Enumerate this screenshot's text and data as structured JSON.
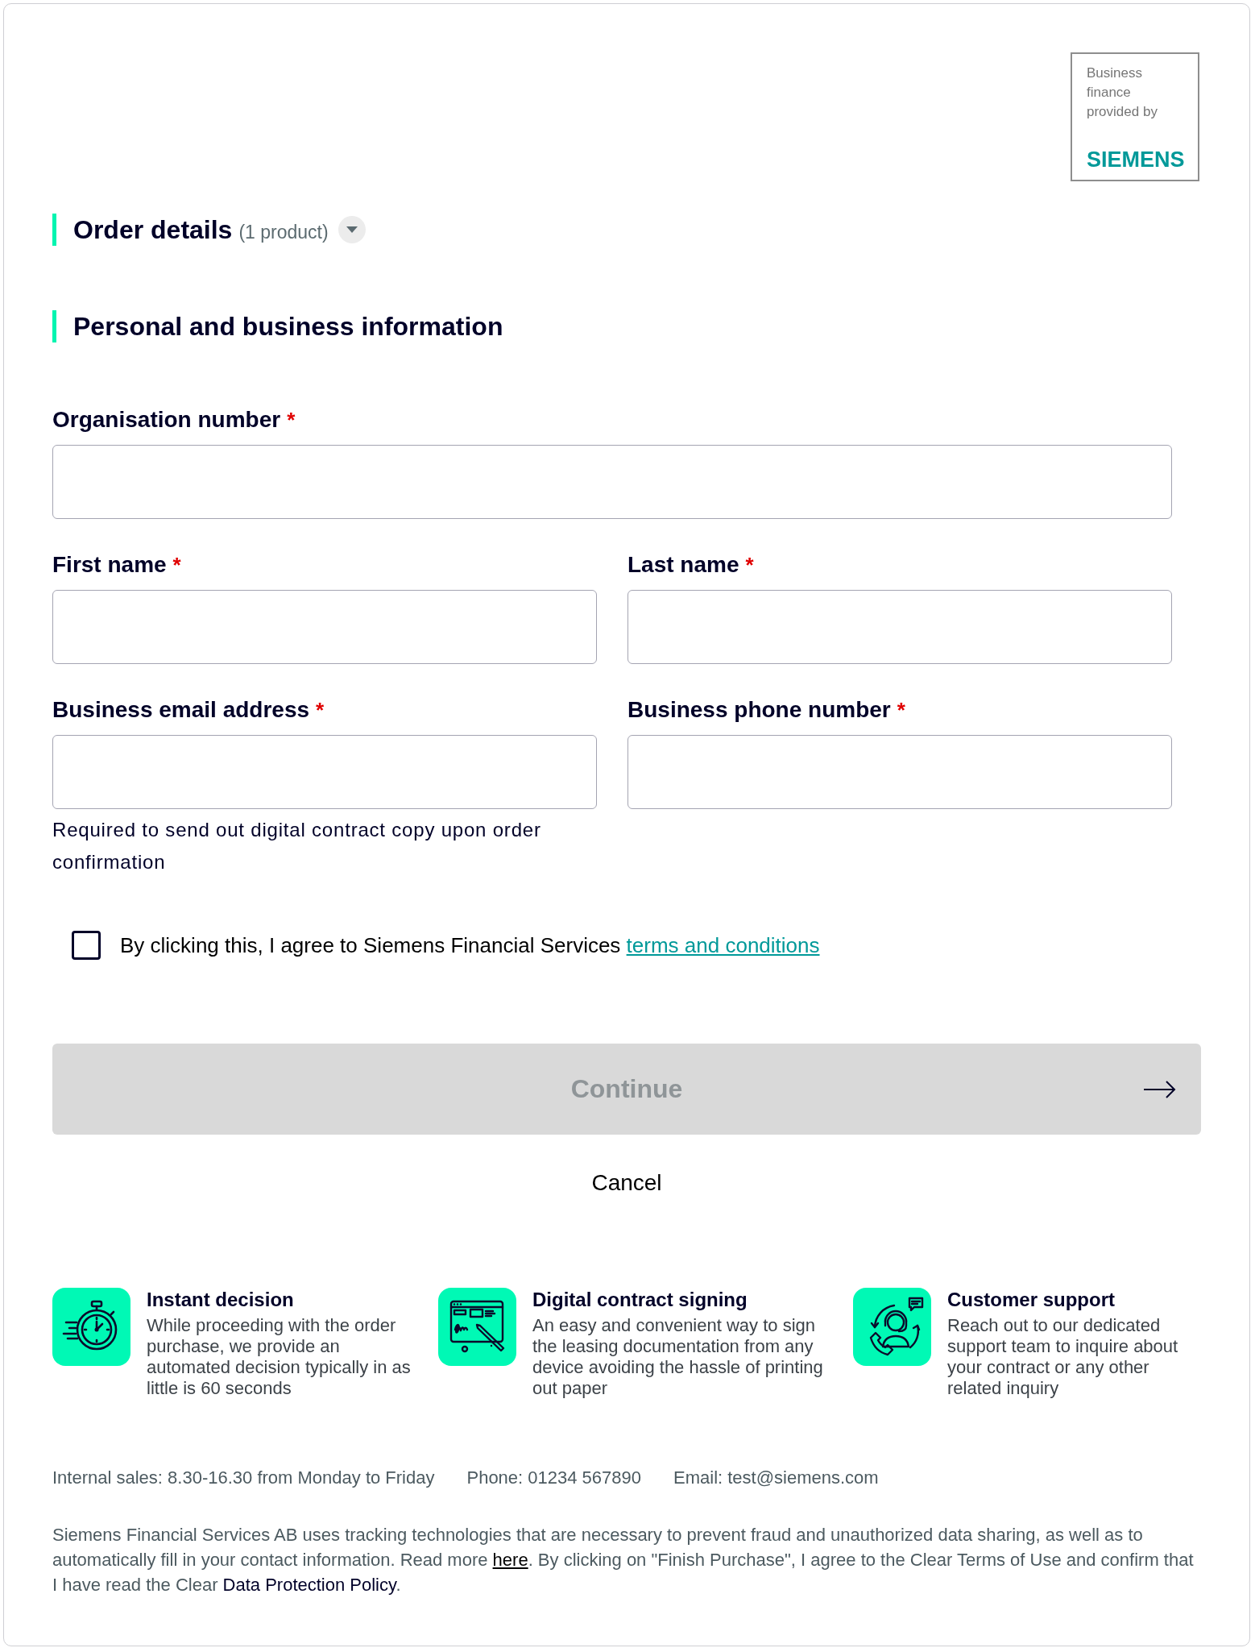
{
  "logo": {
    "tagline": "Business finance provided by",
    "brand": "SIEMENS"
  },
  "order_details": {
    "title": "Order details",
    "count": "(1 product)",
    "expanded": false
  },
  "personal_section": {
    "title": "Personal and business information"
  },
  "form": {
    "required_marker": "*",
    "rows": [
      [
        {
          "label": "Organisation number",
          "required": true
        }
      ],
      [
        {
          "label": "First name",
          "required": true
        },
        {
          "label": "Last name",
          "required": true
        }
      ],
      [
        {
          "label": "Business email address",
          "required": true,
          "helper": "Required to send out digital contract copy upon order confirmation"
        },
        {
          "label": "Business phone number",
          "required": true
        }
      ]
    ]
  },
  "agreement": {
    "text": "By clicking this, I agree to Siemens Financial Services",
    "link": "terms and conditions",
    "checked": false
  },
  "continue_button": {
    "label": "Continue",
    "disabled": true
  },
  "cancel": {
    "label": "Cancel"
  },
  "features": [
    {
      "kind": "stopwatch",
      "title": "Instant decision",
      "description": "While proceeding with the order purchase, we provide an automated decision typically in as little is 60 seconds"
    },
    {
      "kind": "contract",
      "title": "Digital contract signing",
      "description": "An easy and convenient way to sign the leasing documentation from any device avoiding the hassle of printing out paper"
    },
    {
      "kind": "support",
      "title": "Customer support",
      "description": "Reach out to our dedicated support team to inquire about your contract or any other related inquiry"
    }
  ],
  "contact": [
    "Internal sales: 8.30-16.30 from Monday to Friday",
    "Phone: 01234 567890",
    "Email: test@siemens.com"
  ],
  "notice": [
    {
      "kind": "text",
      "text": "Siemens Financial Services AB uses tracking technologies that are necessary to prevent fraud and unauthorized data sharing, as well as to automatically fill in your contact information. Read more "
    },
    {
      "kind": "link",
      "text": "here"
    },
    {
      "kind": "text",
      "text": ". By clicking on \"Finish Purchase\", I agree to the Clear Terms of Use and confirm that I have read the Clear "
    },
    {
      "kind": "policy_link",
      "text": "Data Protection Policy"
    },
    {
      "kind": "text",
      "text": "."
    }
  ]
}
